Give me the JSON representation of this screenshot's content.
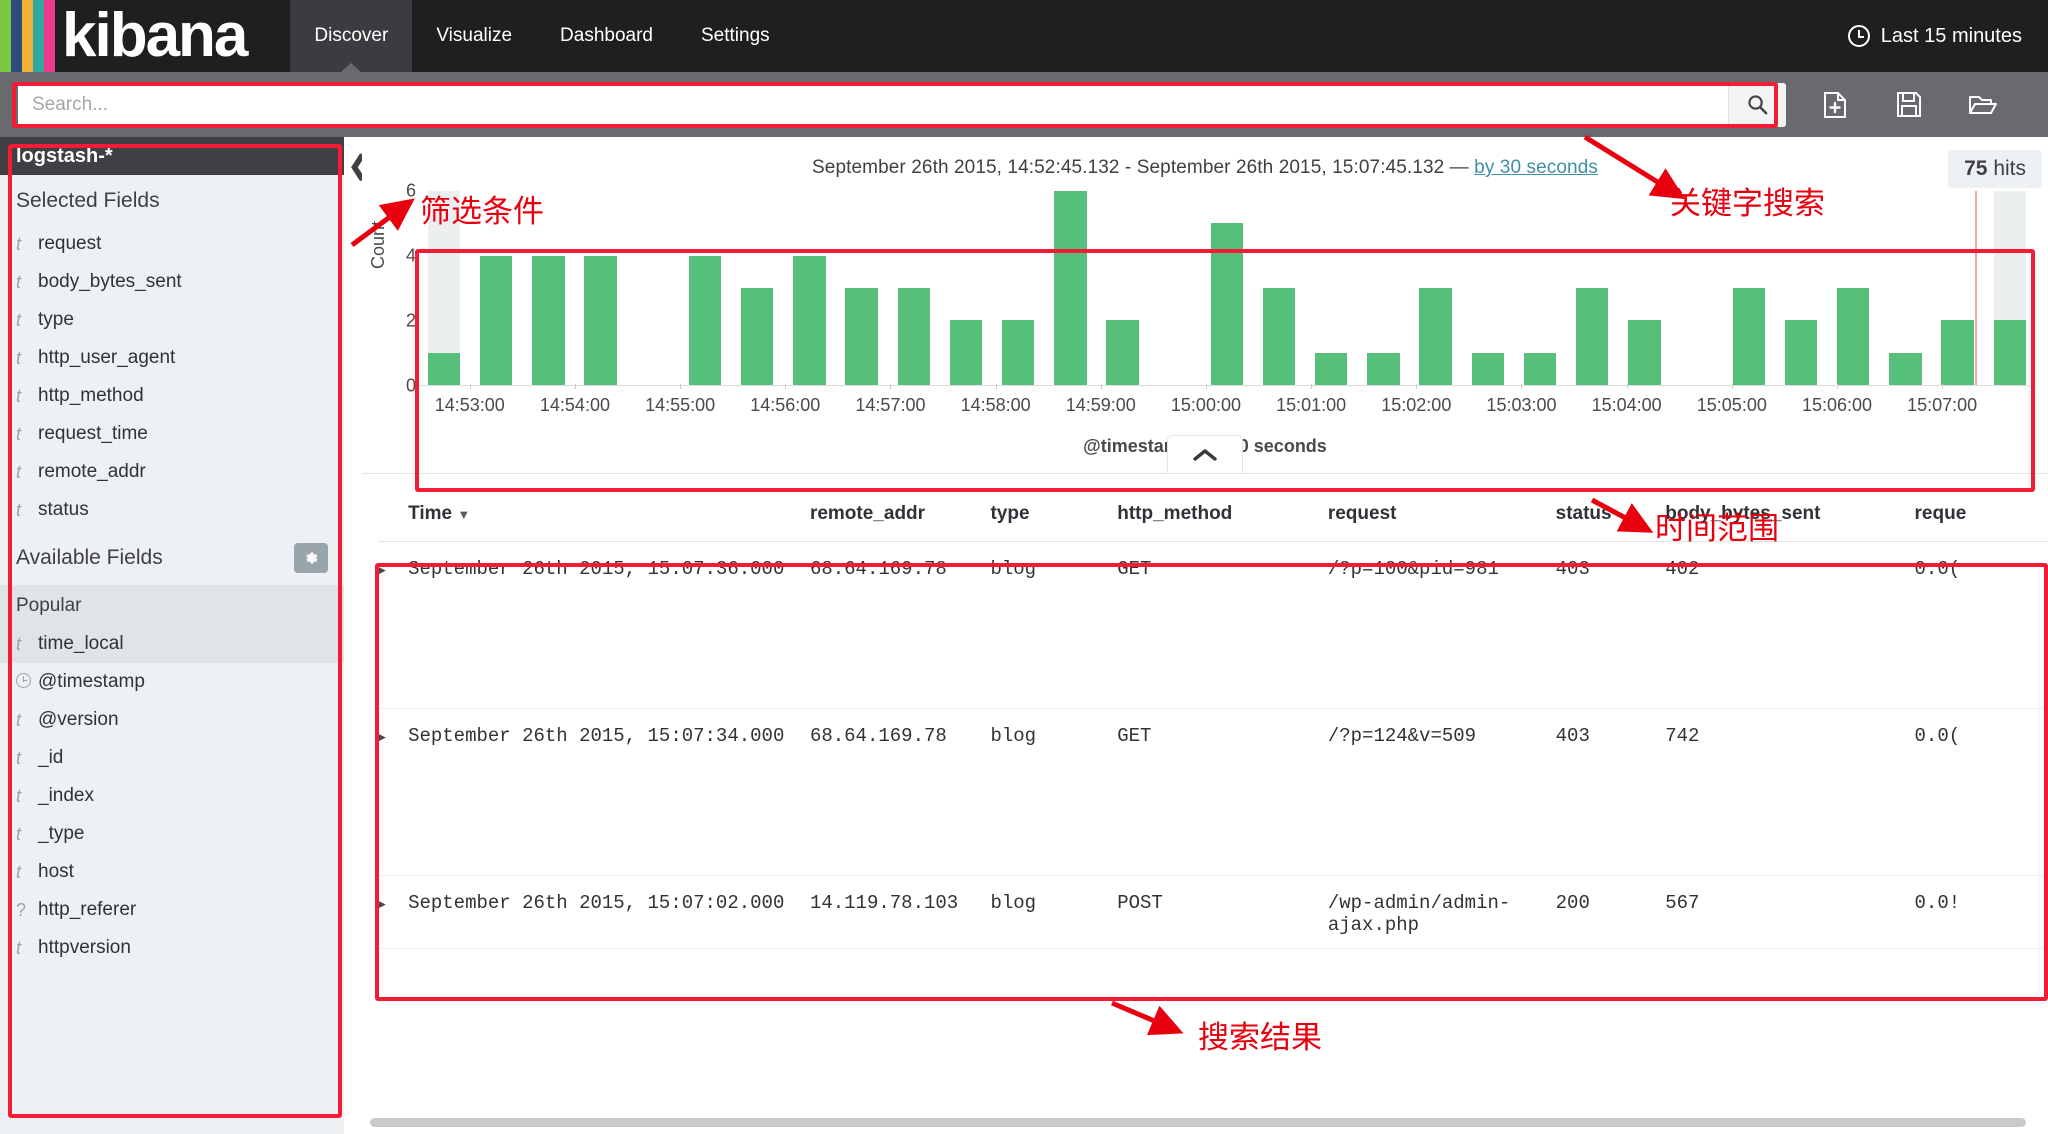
{
  "app": {
    "brand": "kibana",
    "logo_bar_colors": [
      "#7ac943",
      "#2d4b7c",
      "#f2b134",
      "#2fa8a0",
      "#ec3a8f"
    ]
  },
  "nav": {
    "items": [
      {
        "label": "Discover",
        "active": true
      },
      {
        "label": "Visualize",
        "active": false
      },
      {
        "label": "Dashboard",
        "active": false
      },
      {
        "label": "Settings",
        "active": false
      }
    ],
    "time_picker": "Last 15 minutes",
    "time_picker_icon": "clock-icon"
  },
  "search": {
    "placeholder": "Search...",
    "value": "",
    "submit_icon": "search-icon",
    "actions": [
      {
        "icon": "new-document-icon",
        "name": "new-search-button"
      },
      {
        "icon": "save-icon",
        "name": "save-search-button"
      },
      {
        "icon": "open-folder-icon",
        "name": "open-search-button"
      }
    ]
  },
  "sidebar": {
    "index_pattern": "logstash-*",
    "collapse_icon": "chevron-left-icon",
    "selected_fields_header": "Selected Fields",
    "selected_fields": [
      {
        "name": "request",
        "type": "t"
      },
      {
        "name": "body_bytes_sent",
        "type": "t"
      },
      {
        "name": "type",
        "type": "t"
      },
      {
        "name": "http_user_agent",
        "type": "t"
      },
      {
        "name": "http_method",
        "type": "t"
      },
      {
        "name": "request_time",
        "type": "t"
      },
      {
        "name": "remote_addr",
        "type": "t"
      },
      {
        "name": "status",
        "type": "t"
      }
    ],
    "available_fields_header": "Available Fields",
    "settings_icon": "gear-icon",
    "popular_header": "Popular",
    "popular_fields": [
      {
        "name": "time_local",
        "type": "t"
      }
    ],
    "available_fields": [
      {
        "name": "@timestamp",
        "type": "clock"
      },
      {
        "name": "@version",
        "type": "t"
      },
      {
        "name": "_id",
        "type": "t"
      },
      {
        "name": "_index",
        "type": "t"
      },
      {
        "name": "_type",
        "type": "t"
      },
      {
        "name": "host",
        "type": "t"
      },
      {
        "name": "http_referer",
        "type": "?"
      },
      {
        "name": "httpversion",
        "type": "t"
      }
    ]
  },
  "main": {
    "hits_count": "75",
    "hits_label": "hits",
    "collapse_chart_icon": "chevron-up-icon"
  },
  "chart_data": {
    "type": "bar",
    "title": "September 26th 2015, 14:52:45.132 - September 26th 2015, 15:07:45.132 —",
    "interval_link": "by 30 seconds",
    "xlabel": "@timestamp per 30 seconds",
    "ylabel": "Count",
    "ylim": [
      0,
      6
    ],
    "yticks": [
      0,
      2,
      4,
      6
    ],
    "grid": false,
    "bar_color": "#56c07a",
    "categories": [
      "14:52:45",
      "14:53:15",
      "14:53:45",
      "14:54:15",
      "14:54:45",
      "14:55:15",
      "14:55:45",
      "14:56:15",
      "14:56:45",
      "14:57:15",
      "14:57:45",
      "14:58:15",
      "14:58:45",
      "14:59:15",
      "14:59:45",
      "15:00:15",
      "15:00:45",
      "15:01:15",
      "15:01:45",
      "15:02:15",
      "15:02:45",
      "15:03:15",
      "15:03:45",
      "15:04:15",
      "15:04:45",
      "15:05:15",
      "15:05:45",
      "15:06:15",
      "15:06:45",
      "15:07:15",
      "15:07:45"
    ],
    "values": [
      1,
      4,
      4,
      4,
      0,
      4,
      3,
      4,
      3,
      3,
      2,
      2,
      6,
      2,
      0,
      5,
      3,
      1,
      1,
      3,
      1,
      1,
      3,
      2,
      0,
      3,
      2,
      3,
      1,
      2,
      2
    ],
    "xtick_labels": [
      "14:53:00",
      "14:54:00",
      "14:55:00",
      "14:56:00",
      "14:57:00",
      "14:58:00",
      "14:59:00",
      "15:00:00",
      "15:01:00",
      "15:02:00",
      "15:03:00",
      "15:04:00",
      "15:05:00",
      "15:06:00",
      "15:07:00"
    ],
    "xtick_positions_pct": [
      3.2,
      9.7,
      16.2,
      22.7,
      29.2,
      35.7,
      42.2,
      48.7,
      55.2,
      61.7,
      68.2,
      74.7,
      81.2,
      87.7,
      94.2
    ],
    "highlighted_bars": [
      0,
      30
    ],
    "time_marker_pct": 96.2
  },
  "table": {
    "columns": [
      {
        "key": "time",
        "label": "Time",
        "sorted": true,
        "sort_icon": "caret-down-icon"
      },
      {
        "key": "remote_addr",
        "label": "remote_addr"
      },
      {
        "key": "type",
        "label": "type"
      },
      {
        "key": "http_method",
        "label": "http_method"
      },
      {
        "key": "request",
        "label": "request"
      },
      {
        "key": "status",
        "label": "status"
      },
      {
        "key": "body_bytes_sent",
        "label": "body_bytes_sent"
      },
      {
        "key": "request_time",
        "label": "reque"
      }
    ],
    "rows": [
      {
        "expand_icon": "expand-row-icon",
        "time": "September 26th 2015, 15:07:36.000",
        "remote_addr": "68.64.169.78",
        "type": "blog",
        "http_method": "GET",
        "request": "/?p=100&pid=981",
        "status": "403",
        "body_bytes_sent": "402",
        "request_time": "0.0("
      },
      {
        "expand_icon": "expand-row-icon",
        "time": "September 26th 2015, 15:07:34.000",
        "remote_addr": "68.64.169.78",
        "type": "blog",
        "http_method": "GET",
        "request": "/?p=124&v=509",
        "status": "403",
        "body_bytes_sent": "742",
        "request_time": "0.0("
      },
      {
        "expand_icon": "expand-row-icon",
        "time": "September 26th 2015, 15:07:02.000",
        "remote_addr": "14.119.78.103",
        "type": "blog",
        "http_method": "POST",
        "request": "/wp-admin/admin-ajax.php",
        "status": "200",
        "body_bytes_sent": "567",
        "request_time": "0.0!"
      }
    ]
  },
  "annotations": {
    "color": "#e8000e",
    "labels": [
      {
        "id": "filter-conditions",
        "text": "筛选条件"
      },
      {
        "id": "keyword-search",
        "text": "关键字搜索"
      },
      {
        "id": "time-range",
        "text": "时间范围"
      },
      {
        "id": "search-results",
        "text": "搜索结果"
      }
    ]
  }
}
